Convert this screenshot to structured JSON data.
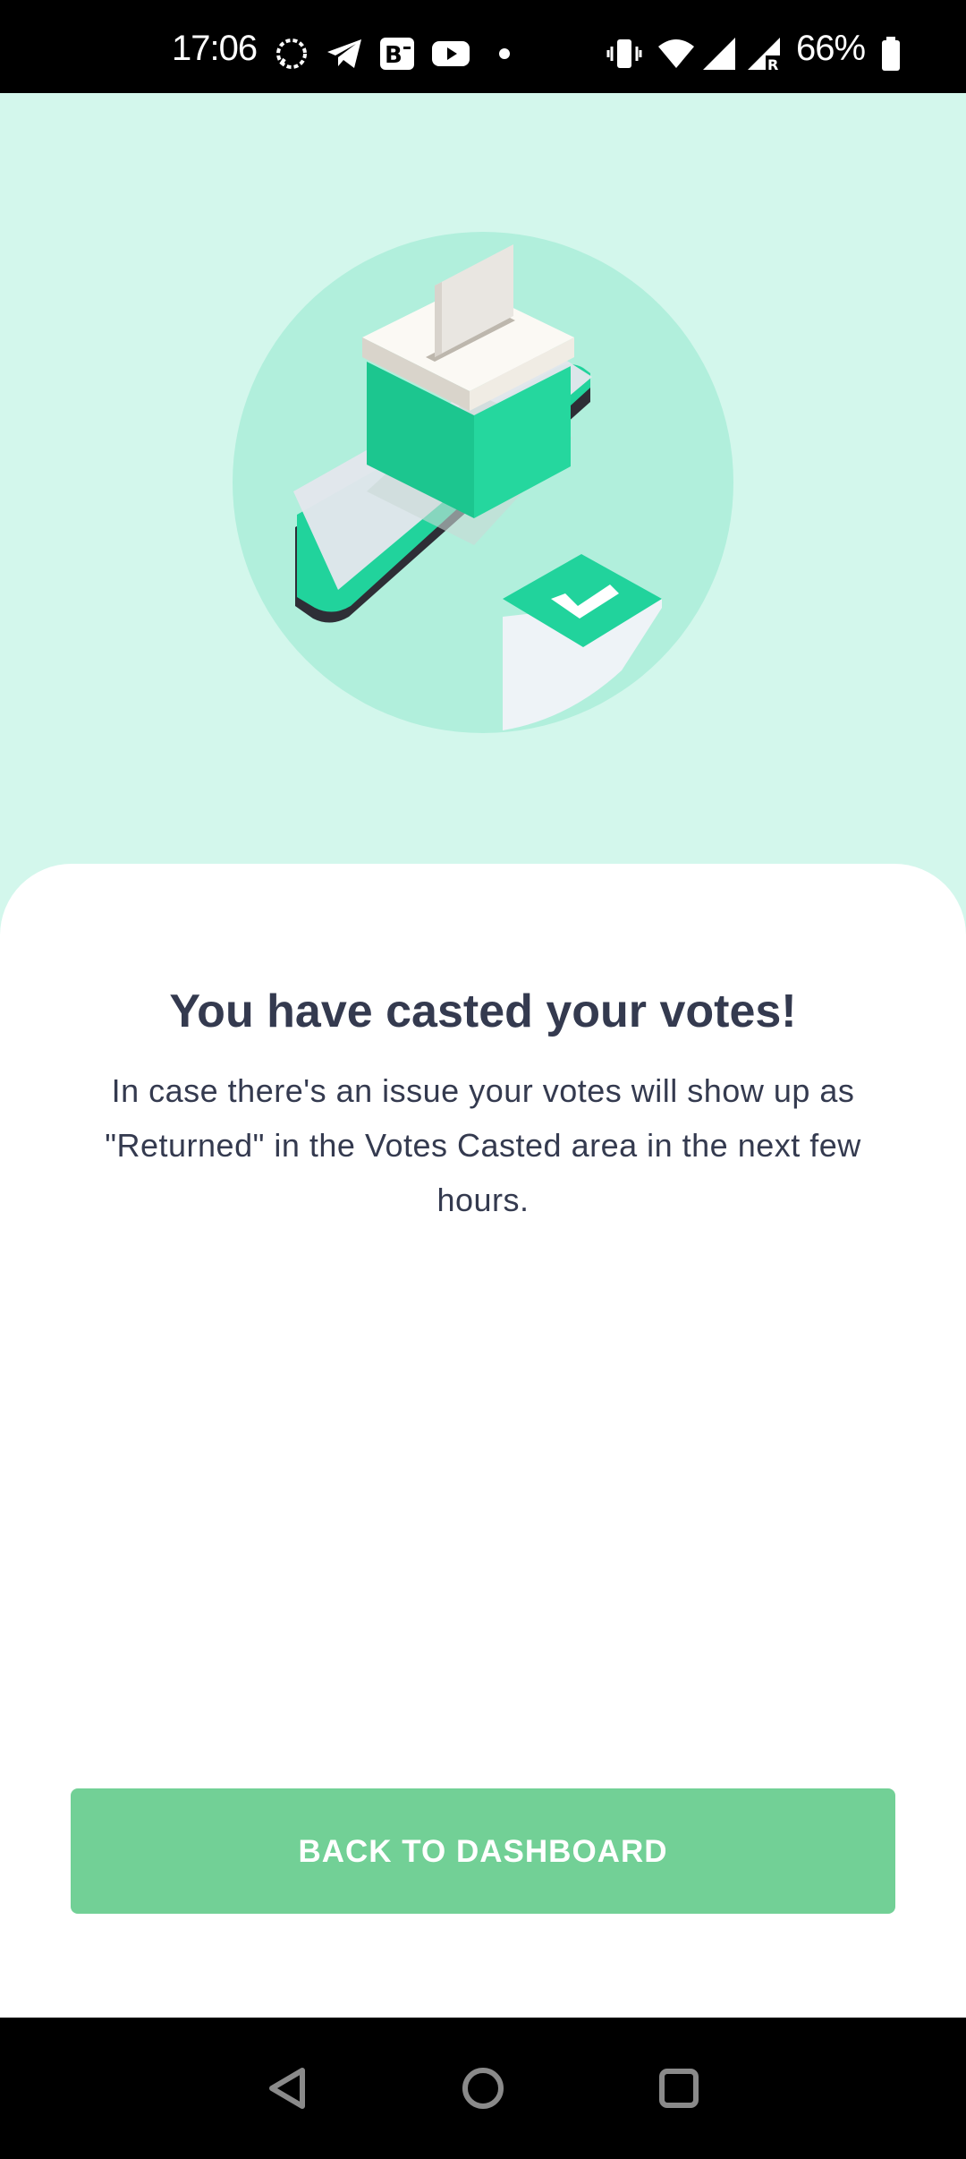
{
  "status_bar": {
    "time": "17:06",
    "battery_percent": "66%",
    "left_icons": [
      "signal-messenger-icon",
      "telegram-icon",
      "behance-icon",
      "youtube-icon",
      "notification-dot-icon"
    ],
    "right_icons": [
      "vibrate-icon",
      "wifi-icon",
      "cell-signal-icon",
      "cell-signal-roaming-icon",
      "battery-icon"
    ]
  },
  "hero": {
    "illustration": "ballot-box-phone-checkmark-illustration",
    "background_color": "#d3f7ec"
  },
  "content": {
    "title": "You have casted your votes!",
    "message": "In case there's an issue your votes will show up as \"Returned\" in the Votes Casted area in the next few hours."
  },
  "actions": {
    "back_to_dashboard_label": "BACK TO DASHBOARD",
    "button_color": "#72d096"
  },
  "nav_bar": {
    "buttons": [
      "back-icon",
      "home-icon",
      "recents-icon"
    ]
  }
}
